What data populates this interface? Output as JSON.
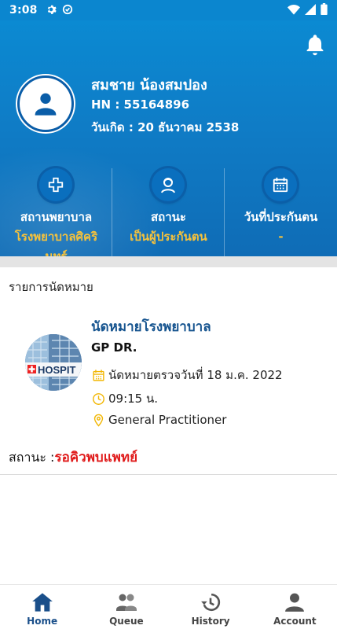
{
  "status_bar": {
    "time": "3:08",
    "icons": [
      "gear-icon",
      "sync-icon",
      "wifi-icon",
      "cell-signal-icon",
      "battery-icon"
    ]
  },
  "header": {
    "patient_name": "สมชาย น้องสมปอง",
    "hn": "HN : 55164896",
    "dob": "วันเกิด : 20 ธันวาคม 2538",
    "notification_icon": "bell-icon"
  },
  "info": [
    {
      "label": "สถานพยาบาล",
      "value_line1": "โรงพยาบาลศิคริ",
      "value_line2": "นทร์",
      "icon": "hospital-cross-icon"
    },
    {
      "label": "สถานะ",
      "value_line1": "เป็นผู้ประกันตน",
      "value_line2": "",
      "icon": "person-icon"
    },
    {
      "label": "วันที่ประกันตน",
      "value_line1": "-",
      "value_line2": "",
      "icon": "calendar-icon"
    }
  ],
  "appointments": {
    "section_title": "รายการนัดหมาย",
    "item": {
      "title": "นัดหมายโรงพยาบาล",
      "doctor": "GP DR.",
      "date": "นัดหมายตรวจวันที่ 18 ม.ค. 2022",
      "time": "09:15 น.",
      "department": "General Practitioner",
      "image_sign": "HOSPIT",
      "status_label": "สถานะ :",
      "status_value": "รอคิวพบแพทย์"
    }
  },
  "nav": [
    {
      "label": "Home",
      "icon": "home-icon",
      "active": true
    },
    {
      "label": "Queue",
      "icon": "queue-icon",
      "active": false
    },
    {
      "label": "History",
      "icon": "history-icon",
      "active": false
    },
    {
      "label": "Account",
      "icon": "account-icon",
      "active": false
    }
  ],
  "colors": {
    "header_blue": "#0b86cf",
    "accent_yellow": "#f6c23c",
    "title_blue": "#16548f",
    "status_red": "#e01b1b",
    "icon_yellow": "#f2b705"
  }
}
